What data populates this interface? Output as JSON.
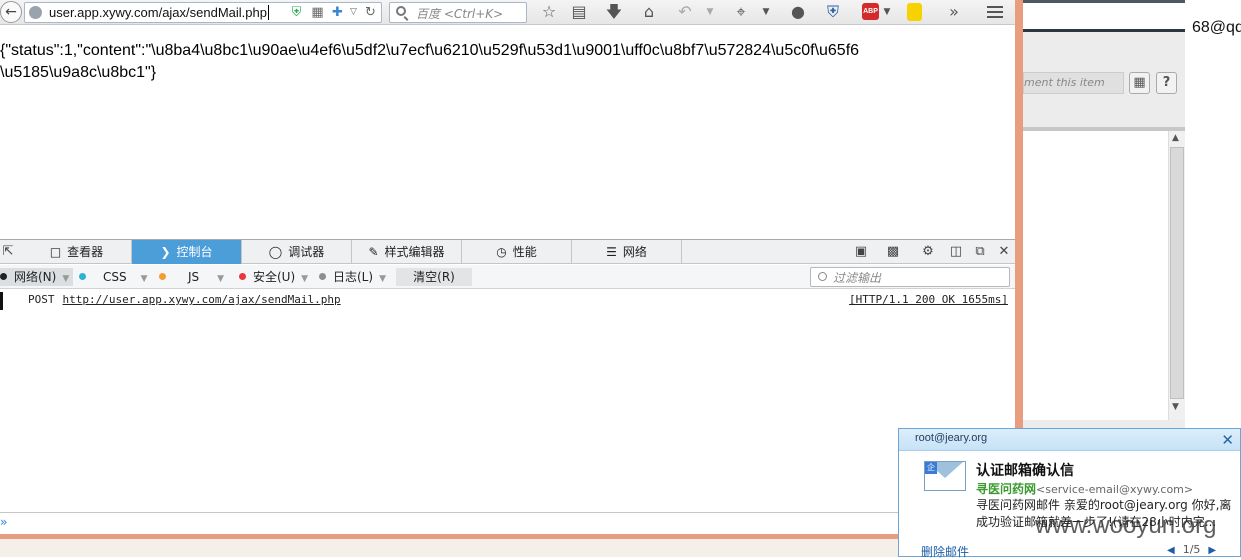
{
  "browser": {
    "url": "user.app.xywy.com/ajax/sendMail.php",
    "search_placeholder": "百度 <Ctrl+K>"
  },
  "page": {
    "line1": "{\"status\":1,\"content\":\"\\u8ba4\\u8bc1\\u90ae\\u4ef6\\u5df2\\u7ecf\\u6210\\u529f\\u53d1\\u9001\\uff0c\\u8bf7\\u572824\\u5c0f\\u65f6",
    "line2": "\\u5185\\u9a8c\\u8bc1\"}"
  },
  "devtools": {
    "tabs": [
      {
        "label": "查看器",
        "icon": "inspector-icon"
      },
      {
        "label": "控制台",
        "icon": "console-icon",
        "active": true
      },
      {
        "label": "调试器",
        "icon": "debugger-icon"
      },
      {
        "label": "样式编辑器",
        "icon": "style-editor-icon"
      },
      {
        "label": "性能",
        "icon": "performance-icon"
      },
      {
        "label": "网络",
        "icon": "network-icon"
      }
    ],
    "filters": {
      "network": "网络(N)",
      "css": "CSS",
      "js": "JS",
      "security": "安全(U)",
      "logging": "日志(L)",
      "clear": "清空(R)",
      "filter_placeholder": "过滤输出"
    },
    "filter_colors": {
      "network": "#222222",
      "css": "#2bb3d6",
      "js": "#f39c32",
      "security": "#e8383d",
      "logging": "#8e8e8e"
    },
    "console_entry": {
      "method": "POST",
      "url": "http://user.app.xywy.com/ajax/sendMail.php",
      "status": "[HTTP/1.1 200 OK 1655ms]"
    },
    "prompt": "»"
  },
  "right_window": {
    "comment_placeholder": "ment this item",
    "email_fragment": "68@qq"
  },
  "mail_popup": {
    "account": "root@jeary.org",
    "subject": "认证邮箱确认信",
    "sender_name": "寻医问药网",
    "sender_email": "<service-email@xywy.com>",
    "preview": "寻医问药网邮件 亲爱的root@jeary.org 你好,离成功验证邮箱就差一步了!(请在28小时内完...",
    "delete_label": "删除邮件",
    "pager": "1/5"
  },
  "watermark": "www.wooyun.org"
}
